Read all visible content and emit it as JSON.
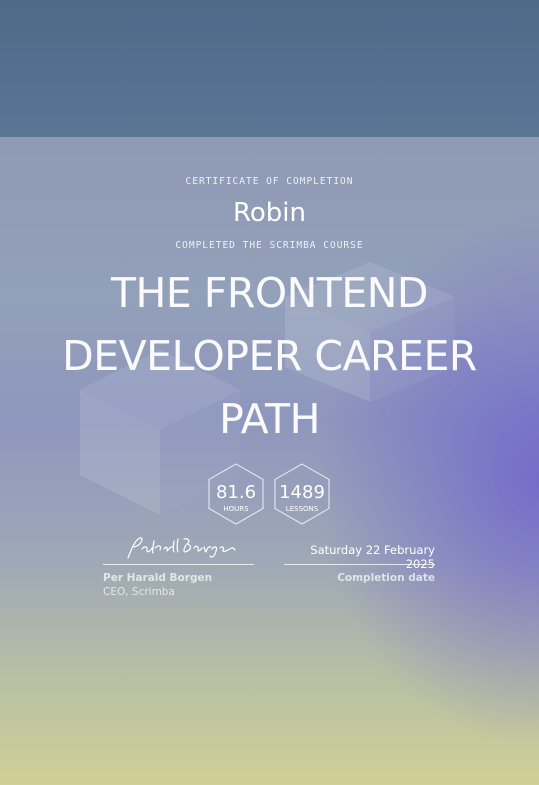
{
  "certificate": {
    "eyebrow": "CERTIFICATE OF COMPLETION",
    "recipient": "Robin",
    "subtitle": "COMPLETED THE SCRIMBA COURSE",
    "course_title": "THE FRONTEND DEVELOPER CAREER PATH"
  },
  "stats": [
    {
      "value": "81.6",
      "label": "HOURS"
    },
    {
      "value": "1489",
      "label": "LESSONS"
    }
  ],
  "signatory": {
    "name": "Per Harald Borgen",
    "title": "CEO, Scrimba",
    "signature_icon": "handwritten-signature"
  },
  "completion": {
    "date": "Saturday 22 February 2025",
    "label": "Completion date"
  },
  "colors": {
    "top_band": "#4f6c8a",
    "accent_purple": "#6e64cd",
    "bottom_yellow": "#d0d096"
  }
}
